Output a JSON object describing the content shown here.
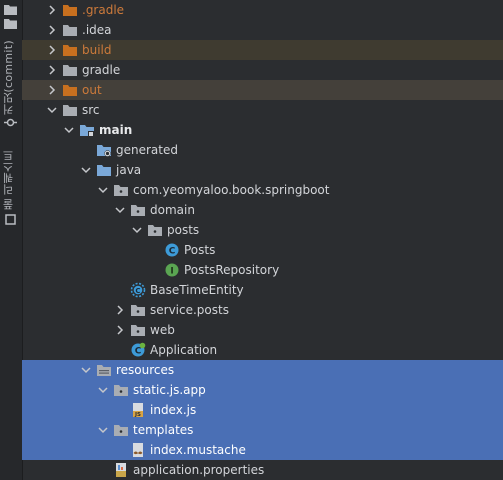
{
  "sidebar": {
    "commit_tab": "커밋(commit)",
    "pull_requests_tab": "풀 리퀘스트"
  },
  "colors": {
    "background": "#2b2d30",
    "selection": "#4a6fb5",
    "folder_blue": "#7aa8d8",
    "folder_orange": "#c8701f",
    "class_icon_blue": "#3d9bd8",
    "interface_icon_green": "#5aa552"
  },
  "tree": [
    {
      "label": ".gradle",
      "chevron": "right",
      "icon": "folder-orange-icon"
    },
    {
      "label": ".idea",
      "chevron": "right",
      "icon": "folder-gray-icon"
    },
    {
      "label": "build",
      "chevron": "right",
      "icon": "folder-orange-icon",
      "highlight": "build"
    },
    {
      "label": "gradle",
      "chevron": "right",
      "icon": "folder-gray-icon"
    },
    {
      "label": "out",
      "chevron": "right",
      "icon": "folder-orange-icon",
      "highlight": "out"
    },
    {
      "label": "src",
      "chevron": "down",
      "icon": "folder-gray-icon"
    },
    {
      "label": "main",
      "chevron": "down",
      "icon": "module-folder-icon"
    },
    {
      "label": "generated",
      "chevron": "none",
      "icon": "generated-sources-icon"
    },
    {
      "label": "java",
      "chevron": "down",
      "icon": "source-root-icon"
    },
    {
      "label": "com.yeomyaloo.book.springboot",
      "chevron": "down",
      "icon": "package-icon"
    },
    {
      "label": "domain",
      "chevron": "down",
      "icon": "package-icon"
    },
    {
      "label": "posts",
      "chevron": "down",
      "icon": "package-icon"
    },
    {
      "label": "Posts",
      "chevron": "none",
      "icon": "class-icon"
    },
    {
      "label": "PostsRepository",
      "chevron": "none",
      "icon": "interface-icon"
    },
    {
      "label": "BaseTimeEntity",
      "chevron": "none",
      "icon": "abstract-class-icon"
    },
    {
      "label": "service.posts",
      "chevron": "right",
      "icon": "package-icon"
    },
    {
      "label": "web",
      "chevron": "right",
      "icon": "package-icon"
    },
    {
      "label": "Application",
      "chevron": "none",
      "icon": "spring-class-icon"
    },
    {
      "label": "resources",
      "chevron": "down",
      "icon": "resources-root-icon",
      "selected": true
    },
    {
      "label": "static.js.app",
      "chevron": "down",
      "icon": "package-icon",
      "selected": true
    },
    {
      "label": "index.js",
      "chevron": "none",
      "icon": "js-file-icon",
      "selected": true
    },
    {
      "label": "templates",
      "chevron": "down",
      "icon": "package-icon",
      "selected": true
    },
    {
      "label": "index.mustache",
      "chevron": "none",
      "icon": "mustache-file-icon",
      "selected": true
    },
    {
      "label": "application.properties",
      "chevron": "none",
      "icon": "properties-file-icon"
    }
  ]
}
